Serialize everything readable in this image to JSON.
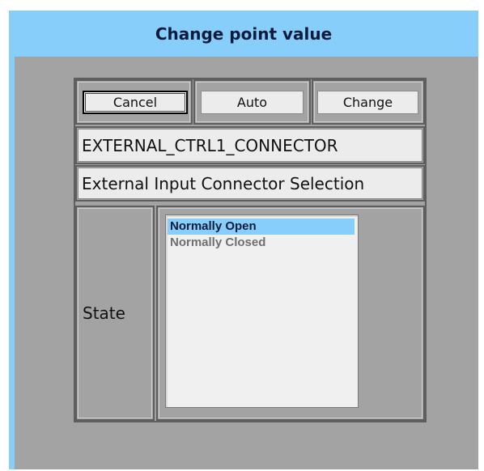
{
  "dialog": {
    "title": "Change point value"
  },
  "buttons": {
    "cancel": "Cancel",
    "auto": "Auto",
    "change": "Change"
  },
  "point": {
    "name": "EXTERNAL_CTRL1_CONNECTOR",
    "description": "External Input Connector Selection"
  },
  "state": {
    "label": "State",
    "options": [
      "Normally Open",
      "Normally Closed"
    ],
    "selected": "Normally Open"
  },
  "colors": {
    "title_bar": "#87cefa",
    "body": "#a3a3a3",
    "selection": "#87cefa",
    "control_bg": "#ececec"
  }
}
